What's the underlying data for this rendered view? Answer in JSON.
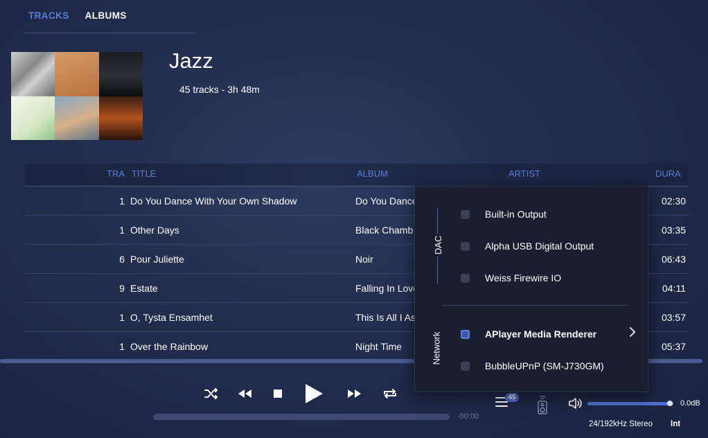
{
  "nav": {
    "tracks": "TRACKS",
    "albums": "ALBUMS"
  },
  "playlist": {
    "title": "Jazz",
    "summary": "45 tracks - 3h 48m"
  },
  "table": {
    "headers": {
      "track": "TRA",
      "title": "TITLE",
      "album": "ALBUM",
      "artist": "ARTIST",
      "duration": "DURA"
    },
    "rows": [
      {
        "num": "1",
        "title": "Do You Dance With Your Own Shadow",
        "album": "Do You Dance",
        "duration": "02:30"
      },
      {
        "num": "1",
        "title": "Other Days",
        "album": "Black Chamb",
        "duration": "03:35"
      },
      {
        "num": "6",
        "title": "Pour Juliette",
        "album": "Noir",
        "duration": "06:43"
      },
      {
        "num": "9",
        "title": "Estate",
        "album": "Falling In Love",
        "duration": "04:11"
      },
      {
        "num": "1",
        "title": "O, Tysta Ensamhet",
        "album": "This Is All I As",
        "duration": "03:57"
      },
      {
        "num": "1",
        "title": "Over the Rainbow",
        "album": "Night Time",
        "duration": "05:37"
      }
    ]
  },
  "player": {
    "time_remaining": "-00:00",
    "queue_count": "45",
    "volume": "0.0dB",
    "format": "24/192kHz Stereo",
    "mode": "Int",
    "volume_level": 0.96
  },
  "output_menu": {
    "dac_label": "DAC",
    "network_label": "Network",
    "dac_outputs": [
      {
        "label": "Built-in Output",
        "selected": false
      },
      {
        "label": "Alpha USB Digital Output",
        "selected": false
      },
      {
        "label": "Weiss Firewire IO",
        "selected": false
      }
    ],
    "network_outputs": [
      {
        "label": "APlayer Media Renderer",
        "selected": true
      },
      {
        "label": "BubbleUPnP (SM-J730GM)",
        "selected": false
      }
    ]
  },
  "colors": {
    "accent": "#5a7fd8",
    "background": "#222d4c",
    "popup": "#1a1f30"
  },
  "icons": [
    "shuffle-icon",
    "rewind-icon",
    "stop-icon",
    "play-icon",
    "fast-forward-icon",
    "repeat-icon",
    "queue-icon",
    "speaker-device-icon",
    "volume-icon",
    "chevron-right-icon"
  ]
}
